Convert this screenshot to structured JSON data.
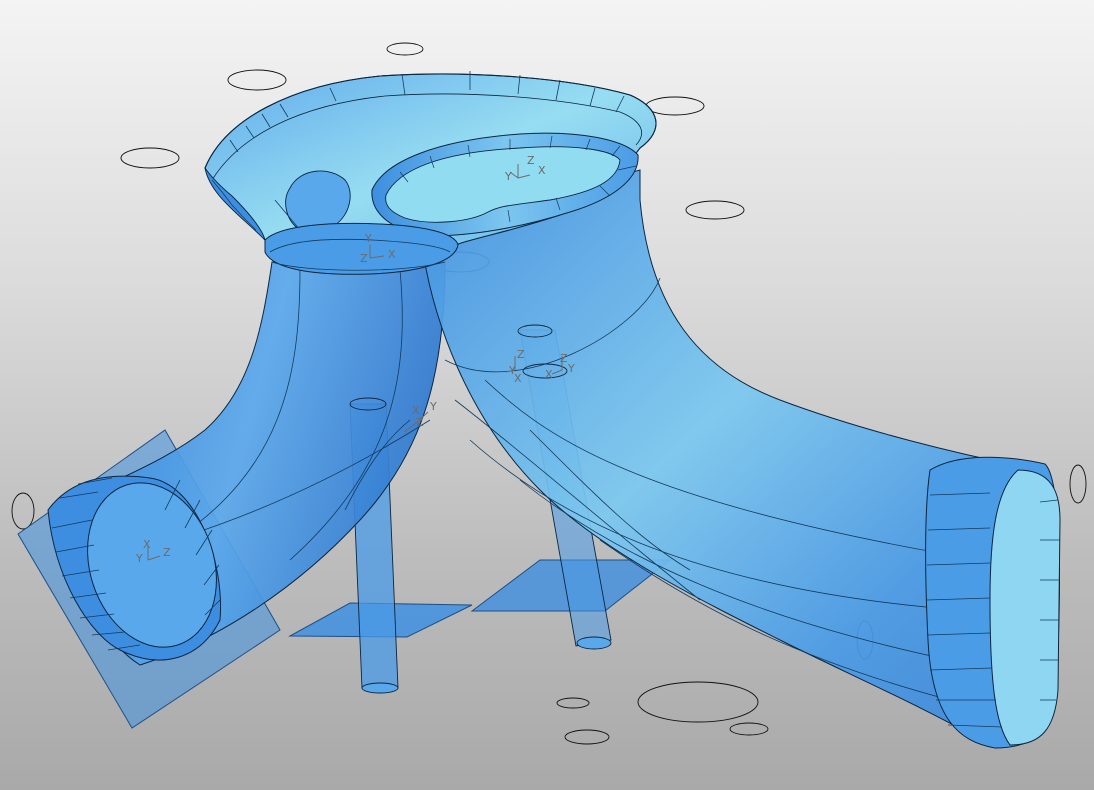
{
  "viewport": {
    "background_top": "#f4f4f4",
    "background_bottom": "#a9a9a9"
  },
  "model": {
    "surface_color": "#4f9fe6",
    "highlight_color": "#8fd6f2",
    "edge_color": "#0b2640",
    "ghost_color": "#111111"
  },
  "triads": [
    {
      "x_label": "X",
      "y_label": "Y",
      "z_label": "Z"
    },
    {
      "x_label": "X",
      "y_label": "Y",
      "z_label": "Z"
    },
    {
      "x_label": "X",
      "y_label": "Y",
      "z_label": "Z"
    },
    {
      "x_label": "X",
      "y_label": "Y",
      "z_label": "Z"
    },
    {
      "x_label": "X",
      "y_label": "Y",
      "z_label": "Z"
    },
    {
      "x_label": "X",
      "y_label": "Y",
      "z_label": "Z"
    }
  ]
}
